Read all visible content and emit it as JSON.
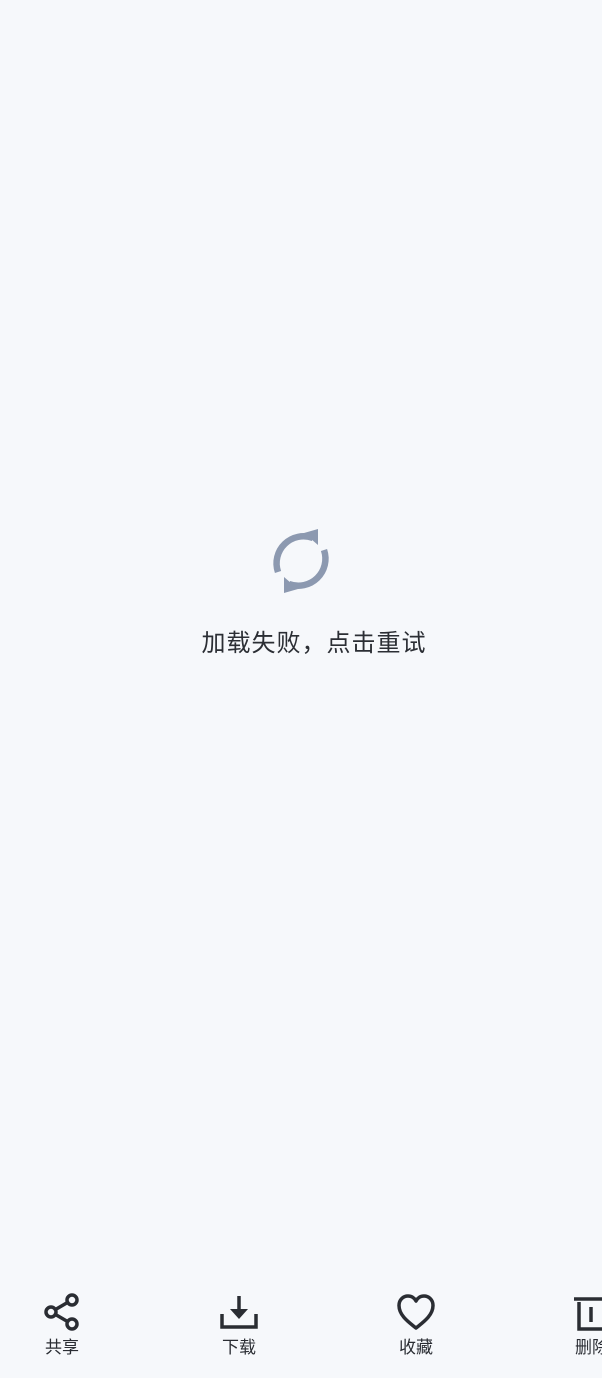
{
  "error": {
    "message": "加载失败，点击重试",
    "icon": "refresh-icon",
    "icon_color": "#8c99b0"
  },
  "toolbar": {
    "share_label": "共享",
    "download_label": "下载",
    "favorite_label": "收藏",
    "delete_label": "删除"
  },
  "colors": {
    "background": "#f6f8fb",
    "text": "#2a2d33"
  }
}
